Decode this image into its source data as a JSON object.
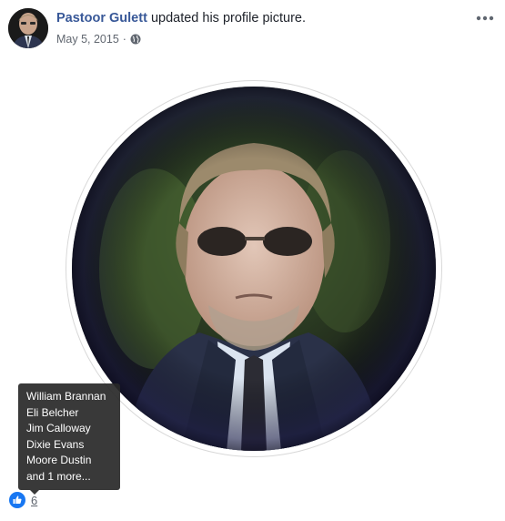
{
  "post": {
    "author": "Pastoor Gulett",
    "action": "updated his profile picture.",
    "date": "May 5, 2015",
    "separator": "·",
    "privacy_icon": "globe-icon",
    "menu_icon": "more-horizontal-icon"
  },
  "reactions": {
    "icon": "like-icon",
    "count": "6",
    "tooltip": [
      "William Brannan",
      "Eli Belcher",
      "Jim Calloway",
      "Dixie Evans",
      "Moore Dustin",
      "and 1 more..."
    ]
  },
  "colors": {
    "author_link": "#385898",
    "meta_text": "#616770",
    "like_blue": "#1877f2",
    "tooltip_bg": "#282828"
  }
}
